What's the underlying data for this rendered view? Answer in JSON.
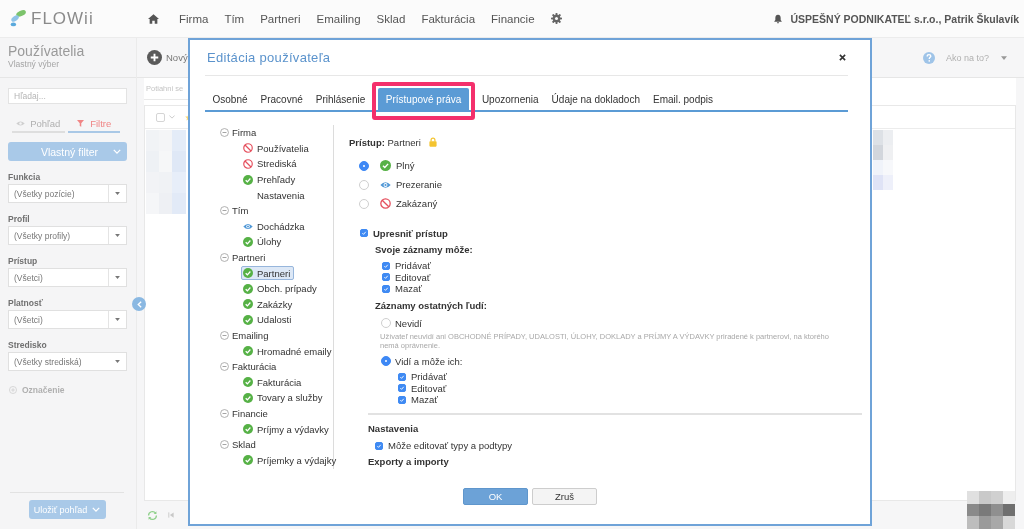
{
  "topbar": {
    "logo": "FLOWii",
    "nav": [
      "Firma",
      "Tím",
      "Partneri",
      "Emailing",
      "Sklad",
      "Fakturácia",
      "Financie"
    ],
    "account": "ÚSPEŠNÝ PODNIKATEĽ s.r.o., Patrik Škulavík"
  },
  "sidebar": {
    "title": "Používatelia",
    "subtitle": "Vlastný výber",
    "search": {
      "placeholder": "Hľadaj..."
    },
    "tabs": [
      {
        "label": "Pohľad",
        "selected": false
      },
      {
        "label": "Filtre",
        "selected": true
      }
    ],
    "filter_button": "Vlastný filter",
    "filters": [
      {
        "label": "Funkcia",
        "value": "(Všetky pozície)"
      },
      {
        "label": "Profil",
        "value": "(Všetky profily)"
      },
      {
        "label": "Prístup",
        "value": "(Všetci)"
      },
      {
        "label": "Platnosť",
        "value": "(Všetci)"
      },
      {
        "label": "Stredisko",
        "value": "(Všetky strediská)"
      }
    ],
    "add_filter": "Označenie",
    "save_button": "Uložiť pohľad"
  },
  "header": {
    "new_button": "Nový",
    "help": "Ako na to?"
  },
  "list": {
    "group_hint": "Potiahni se",
    "select_all": {
      "checked": false
    }
  },
  "modal": {
    "title": "Editácia používateľa",
    "tabs": [
      {
        "label": "Osobné",
        "selected": false,
        "highlighted": false
      },
      {
        "label": "Pracovné",
        "selected": false,
        "highlighted": false
      },
      {
        "label": "Prihlásenie",
        "selected": false,
        "highlighted": false
      },
      {
        "label": "Prístupové práva",
        "selected": true,
        "highlighted": true
      },
      {
        "label": "Upozornenia",
        "selected": false,
        "highlighted": false
      },
      {
        "label": "Údaje na dokladoch",
        "selected": false,
        "highlighted": false
      },
      {
        "label": "Email. podpis",
        "selected": false,
        "highlighted": false
      }
    ],
    "tree": [
      {
        "label": "Firma",
        "expanded": true,
        "children": [
          {
            "label": "Používatelia",
            "kind": "denied",
            "selected": false
          },
          {
            "label": "Strediská",
            "kind": "denied",
            "selected": false
          },
          {
            "label": "Prehľady",
            "kind": "full",
            "selected": false
          },
          {
            "label": "Nastavenia",
            "kind": "plain",
            "selected": false
          }
        ]
      },
      {
        "label": "Tím",
        "expanded": true,
        "children": [
          {
            "label": "Dochádzka",
            "kind": "view",
            "selected": false
          },
          {
            "label": "Úlohy",
            "kind": "full",
            "selected": false
          }
        ]
      },
      {
        "label": "Partneri",
        "expanded": true,
        "children": [
          {
            "label": "Partneri",
            "kind": "full",
            "selected": true
          },
          {
            "label": "Obch. prípady",
            "kind": "full",
            "selected": false
          },
          {
            "label": "Zakázky",
            "kind": "full",
            "selected": false
          },
          {
            "label": "Udalosti",
            "kind": "full",
            "selected": false
          }
        ]
      },
      {
        "label": "Emailing",
        "expanded": true,
        "children": [
          {
            "label": "Hromadné emaily",
            "kind": "full",
            "selected": false
          }
        ]
      },
      {
        "label": "Fakturácia",
        "expanded": true,
        "children": [
          {
            "label": "Fakturácia",
            "kind": "full",
            "selected": false
          },
          {
            "label": "Tovary a služby",
            "kind": "full",
            "selected": false
          }
        ]
      },
      {
        "label": "Financie",
        "expanded": true,
        "children": [
          {
            "label": "Príjmy a výdavky",
            "kind": "full",
            "selected": false
          }
        ]
      },
      {
        "label": "Sklad",
        "expanded": true,
        "children": [
          {
            "label": "Príjemky a výdajky",
            "kind": "full",
            "selected": false
          }
        ]
      }
    ],
    "access_heading": "**Prístup:** Partneri",
    "access_options": [
      {
        "label": "Plný",
        "kind": "full",
        "selected": true
      },
      {
        "label": "Prezeranie",
        "kind": "view",
        "selected": false
      },
      {
        "label": "Zakázaný",
        "kind": "denied",
        "selected": false
      }
    ],
    "refine": {
      "label": "Upresniť prístup",
      "checked": true
    },
    "own_records": {
      "title": "Svoje záznamy môže:",
      "permissions": [
        {
          "label": "Pridávať",
          "checked": true
        },
        {
          "label": "Editovať",
          "checked": true
        },
        {
          "label": "Mazať",
          "checked": true
        }
      ]
    },
    "others_records": {
      "title": "Záznamy ostatných ľudí:",
      "options": [
        {
          "label": "Nevidí",
          "selected": false,
          "note": "Užívateľ neuvidí ani OBCHODNÉ PRÍPADY, UDALOSTI, ÚLOHY, DOKLADY a PRÍJMY A VÝDAVKY priradené k partnerovi, na ktorého nemá oprávnenie."
        },
        {
          "label": "Vidí a môže ich:",
          "selected": true,
          "permissions": [
            {
              "label": "Pridávať",
              "checked": true
            },
            {
              "label": "Editovať",
              "checked": true
            },
            {
              "label": "Mazať",
              "checked": true
            }
          ]
        }
      ]
    },
    "settings": {
      "title": "Nastavenia",
      "options": [
        {
          "label": "Môže editovať typy a podtypy",
          "checked": true
        }
      ]
    },
    "next_section_title": "Exporty a importy",
    "buttons": [
      {
        "label": "OK",
        "kind": "primary"
      },
      {
        "label": "Zruš",
        "kind": "secondary"
      }
    ]
  }
}
